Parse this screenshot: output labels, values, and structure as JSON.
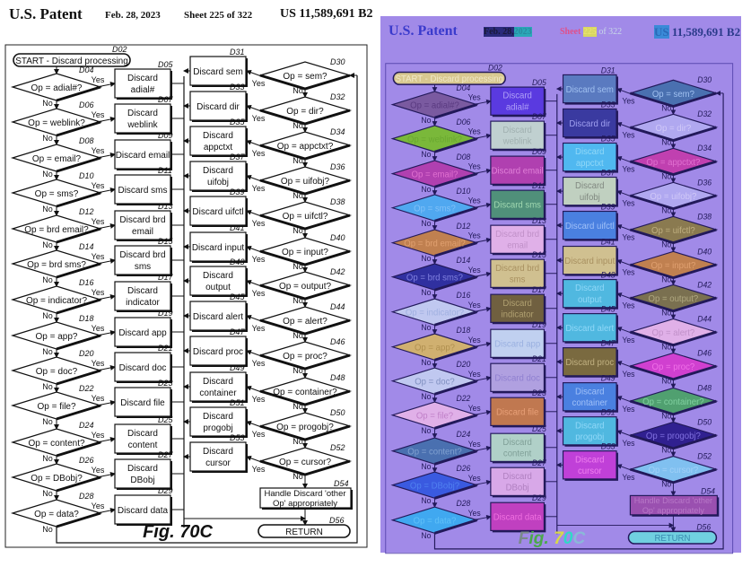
{
  "header": {
    "title": "U.S. Patent",
    "date": "Feb. 28, 2023",
    "sheet": "Sheet 225 of 322",
    "patent_number": "US 11,589,691 B2"
  },
  "header_colorized": {
    "title": "U.S. Patent",
    "date_part1": "Feb. 28,",
    "date_part2": "2023",
    "sheet_part1": "Sheet",
    "sheet_part2": "225",
    "sheet_part3": "of 322",
    "patent_part1": "US",
    "patent_part2": "11,589,691 B2",
    "colors": {
      "title": "#3a3acc",
      "date_bg1": "#2a2a7a",
      "date_bg2": "#2aa8b8",
      "sheet1": "#e0508a",
      "sheet2_bg": "#d8d860",
      "sheet3": "#c8d8e8",
      "patent1_bg": "#3a8ad8",
      "patent2": "#2a3a8a"
    }
  },
  "figure_label": "Fig. 70C",
  "figure_label_colorized": {
    "parts": [
      "F",
      "ig.",
      " 7",
      "0",
      "C"
    ],
    "colors": [
      "#7a8a8a",
      "#4aa84a",
      "#d8d84a",
      "#30d8c8",
      "#8ab8d8"
    ]
  },
  "start": {
    "label": "START - Discard processing",
    "ref": "D02"
  },
  "left_decisions": [
    {
      "ref": "D04",
      "label": "Op = adial#?"
    },
    {
      "ref": "D06",
      "label": "Op = weblink?"
    },
    {
      "ref": "D08",
      "label": "Op = email?"
    },
    {
      "ref": "D10",
      "label": "Op = sms?"
    },
    {
      "ref": "D12",
      "label": "Op = brd email?"
    },
    {
      "ref": "D14",
      "label": "Op = brd sms?"
    },
    {
      "ref": "D16",
      "label": "Op = indicator?"
    },
    {
      "ref": "D18",
      "label": "Op = app?"
    },
    {
      "ref": "D20",
      "label": "Op = doc?"
    },
    {
      "ref": "D22",
      "label": "Op = file?"
    },
    {
      "ref": "D24",
      "label": "Op = content?"
    },
    {
      "ref": "D26",
      "label": "Op = DBobj?"
    },
    {
      "ref": "D28",
      "label": "Op = data?"
    }
  ],
  "left_actions": [
    {
      "ref": "D05",
      "lines": [
        "Discard",
        "adial#"
      ]
    },
    {
      "ref": "D07",
      "lines": [
        "Discard",
        "weblink"
      ]
    },
    {
      "ref": "D09",
      "lines": [
        "Discard email"
      ]
    },
    {
      "ref": "D11",
      "lines": [
        "Discard sms"
      ]
    },
    {
      "ref": "D13",
      "lines": [
        "Discard brd",
        "email"
      ]
    },
    {
      "ref": "D15",
      "lines": [
        "Discard brd",
        "sms"
      ]
    },
    {
      "ref": "D17",
      "lines": [
        "Discard",
        "indicator"
      ]
    },
    {
      "ref": "D19",
      "lines": [
        "Discard app"
      ]
    },
    {
      "ref": "D21",
      "lines": [
        "Discard doc"
      ]
    },
    {
      "ref": "D23",
      "lines": [
        "Discard file"
      ]
    },
    {
      "ref": "D25",
      "lines": [
        "Discard",
        "content"
      ]
    },
    {
      "ref": "D27",
      "lines": [
        "Discard",
        "DBobj"
      ]
    },
    {
      "ref": "D29",
      "lines": [
        "Discard data"
      ]
    }
  ],
  "right_decisions": [
    {
      "ref": "D30",
      "label": "Op = sem?"
    },
    {
      "ref": "D32",
      "label": "Op = dir?"
    },
    {
      "ref": "D34",
      "label": "Op = appctxt?"
    },
    {
      "ref": "D36",
      "label": "Op = uifobj?"
    },
    {
      "ref": "D38",
      "label": "Op = uifctl?"
    },
    {
      "ref": "D40",
      "label": "Op = input?"
    },
    {
      "ref": "D42",
      "label": "Op = output?"
    },
    {
      "ref": "D44",
      "label": "Op = alert?"
    },
    {
      "ref": "D46",
      "label": "Op = proc?"
    },
    {
      "ref": "D48",
      "label": "Op = container?"
    },
    {
      "ref": "D50",
      "label": "Op = progobj?"
    },
    {
      "ref": "D52",
      "label": "Op = cursor?"
    }
  ],
  "right_actions": [
    {
      "ref": "D31",
      "lines": [
        "Discard sem"
      ]
    },
    {
      "ref": "D33",
      "lines": [
        "Discard dir"
      ]
    },
    {
      "ref": "D35",
      "lines": [
        "Discard",
        "appctxt"
      ]
    },
    {
      "ref": "D37",
      "lines": [
        "Discard",
        "uifobj"
      ]
    },
    {
      "ref": "D39",
      "lines": [
        "Discard uifctl"
      ]
    },
    {
      "ref": "D41",
      "lines": [
        "Discard input"
      ]
    },
    {
      "ref": "D43",
      "lines": [
        "Discard",
        "output"
      ]
    },
    {
      "ref": "D45",
      "lines": [
        "Discard alert"
      ]
    },
    {
      "ref": "D47",
      "lines": [
        "Discard proc"
      ]
    },
    {
      "ref": "D49",
      "lines": [
        "Discard",
        "container"
      ]
    },
    {
      "ref": "D51",
      "lines": [
        "Discard",
        "progobj"
      ]
    },
    {
      "ref": "D53",
      "lines": [
        "Discard",
        "cursor"
      ]
    }
  ],
  "handle_other": {
    "ref": "D54",
    "lines": [
      "Handle Discard 'other",
      "Op' appropriately"
    ]
  },
  "return": {
    "ref": "D56",
    "label": "RETURN"
  },
  "branch_labels": {
    "yes": "Yes",
    "no": "No"
  },
  "colorized": {
    "start_fill": "#d8c890",
    "return_fill": "#70d0e0",
    "handle_fill": "#9a50b0",
    "left_decision_fills": [
      "#7a5aa0",
      "#7ab83a",
      "#b040b0",
      "#50a8f0",
      "#c08050",
      "#3030a0",
      "#c0c8f0",
      "#d0b070",
      "#c0c8f0",
      "#e0b0e8",
      "#4a70b0",
      "#3a5ae0",
      "#40a8f0"
    ],
    "left_decision_text": [
      "#5a3a80",
      "#6aa830",
      "#e070d0",
      "#80c0f8",
      "#e0a070",
      "#8080e0",
      "#a0b0e0",
      "#b09050",
      "#8090c0",
      "#c080c8",
      "#80a0d0",
      "#5080f0",
      "#60c0f8"
    ],
    "left_action_fills": [
      "#5a3ae0",
      "#c0d0d0",
      "#b040b0",
      "#50907a",
      "#e0b0e8",
      "#d0c090",
      "#706040",
      "#c0d0f0",
      "#b0a0e0",
      "#c07850",
      "#b0d0c8",
      "#d8a8e8",
      "#c040c0"
    ],
    "left_action_text": [
      "#b0a0f8",
      "#a0b0b0",
      "#e080d8",
      "#a0d8b0",
      "#c090c8",
      "#a89060",
      "#b0a070",
      "#9ab0e0",
      "#9080d0",
      "#e8a078",
      "#80a098",
      "#b080c0",
      "#f070e0"
    ],
    "right_decision_fills": [
      "#4a70b0",
      "#b0a8f0",
      "#c040b0",
      "#b0a8f0",
      "#8a7a50",
      "#c08050",
      "#7a7050",
      "#e0b0e8",
      "#d040d0",
      "#50a070",
      "#302090",
      "#80c0f0"
    ],
    "right_decision_text": [
      "#a0c0f0",
      "#d0c8f8",
      "#e070d0",
      "#d0c8f8",
      "#c0b080",
      "#e0a070",
      "#b0a880",
      "#c090c8",
      "#f070e8",
      "#80d0a0",
      "#8070e0",
      "#a0d0f8"
    ],
    "right_action_fills": [
      "#5a7ac0",
      "#3a3aa0",
      "#50b8f0",
      "#c0d0c0",
      "#4a80e0",
      "#d0c090",
      "#50b8e0",
      "#50b8e0",
      "#7a6a40",
      "#4a80e0",
      "#50b8e0",
      "#c040d8"
    ],
    "right_action_text": [
      "#a0c0f0",
      "#a0a0f0",
      "#90d8f8",
      "#808880",
      "#a0c0f8",
      "#a89060",
      "#90d8f8",
      "#90d8f8",
      "#c0b080",
      "#a0c0f8",
      "#90d8f8",
      "#f080f0"
    ]
  }
}
